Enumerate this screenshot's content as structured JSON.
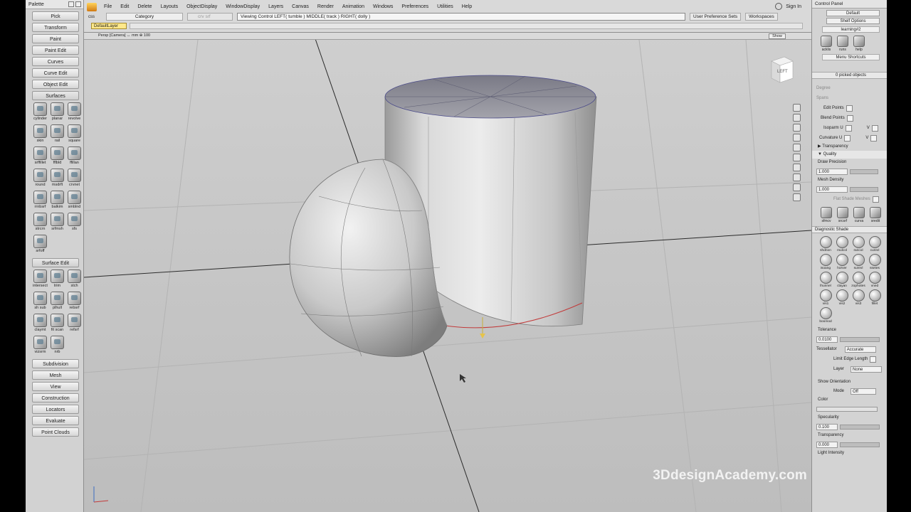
{
  "palette": {
    "title": "Palette",
    "buttons_top": [
      "Pick",
      "Transform",
      "Paint",
      "Paint Edit",
      "Curves",
      "Curve Edit",
      "Object Edit"
    ],
    "surfaces_header": "Surfaces",
    "surface_tools": [
      "cylinder",
      "planar",
      "revolve",
      "skin",
      "rail",
      "square",
      "srffillet",
      "fflbld",
      "ffillan",
      "round",
      "msdrft",
      "crvnet",
      "rrnbsrf",
      "balkim",
      "smblnd",
      "strcrn",
      "srfmsh",
      "sfs",
      "srfoff"
    ],
    "surface_edit_header": "Surface Edit",
    "surface_edit_tools": [
      "intersect",
      "trim",
      "stch",
      "sh sub",
      "plhull",
      "rebsrf",
      "claymt",
      "fit scan",
      "refsrf",
      "vizsrm",
      "nrb"
    ],
    "buttons_bottom": [
      "Subdivision",
      "Mesh",
      "View",
      "Construction",
      "Locators",
      "Evaluate",
      "Point Clouds"
    ]
  },
  "menu": {
    "items": [
      "File",
      "Edit",
      "Delete",
      "Layouts",
      "ObjectDisplay",
      "WindowDisplay",
      "Layers",
      "Canvas",
      "Render",
      "Animation",
      "Windows",
      "Preferences",
      "Utilities",
      "Help"
    ],
    "sign_in": "Sign In"
  },
  "toolbar": {
    "left_code": "css",
    "category": "Category",
    "crv_srf": "crv srf",
    "viewing_control": "Viewing Control   LEFT( tumble )   MIDDLE( track )   RIGHT( dolly )",
    "user_pref_sets": "User Preference Sets",
    "workspaces": "Workspaces",
    "default_layer": "DefaultLayer"
  },
  "viewport": {
    "header": "Persp [Camera]  ↔ mm   ⊕ 100",
    "show_label": "Show",
    "view_cube_label": "LEFT",
    "watermark": "3DdesignAcademy.com"
  },
  "control_panel": {
    "title": "Control Panel",
    "preset": "Default",
    "shelf_options": "Shelf Options",
    "shelf_tab": "learning#2",
    "shelf_icons": [
      "acklis",
      "runs",
      "help"
    ],
    "menu_shortcuts": "Menu Shortcuts",
    "picked": "0 picked objects",
    "degree_label": "Degree",
    "spans_label": "Spans",
    "edit_points": "Edit Points",
    "blend_points": "Blend Points",
    "isoparm_u": "Isoparm U",
    "isoparm_v": "V",
    "curvature_u": "Curvature U",
    "curvature_v": "V",
    "transparency_section": "Transparency",
    "quality_section": "Quality",
    "draw_precision_label": "Draw Precision",
    "draw_precision_value": "1.000",
    "mesh_density_label": "Mesh Density",
    "mesh_density_value": "1.000",
    "flat_shade_meshes": "Flat Shade Meshes",
    "shelf2_icons": [
      "sfmcv",
      "srcsrf",
      "curva",
      "sredit"
    ],
    "diagnostic_shade": "Diagnostic Shade",
    "diag_icons": [
      "shdnon",
      "mulcol",
      "rancol",
      "curevl",
      "isoang",
      "horver",
      "surevl",
      "ssetes",
      "lhunnel",
      "clayan",
      "zophotes",
      "vned",
      "vis1",
      "vis2",
      "vis3",
      "fillet",
      "boomod"
    ],
    "tolerance_label": "Tolerance",
    "tolerance_value": "0.0100",
    "tessellator_label": "Tessellator",
    "tessellator_value": "Accurate",
    "limit_edge_length": "Limit Edge Length",
    "layer_label": "Layer",
    "layer_value": "None",
    "show_orientation": "Show Orientation",
    "mode_label": "Mode",
    "mode_value": "Off",
    "color_label": "Color",
    "specularity_label": "Specularity",
    "specularity_value": "0.100",
    "transparency_label": "Transparency",
    "transparency_value": "0.000",
    "light_intensity_label": "Light Intensity"
  },
  "colors": {
    "layer_yellow": "#ffe88a",
    "cylinder_cap": "#8f8f9a",
    "seam_red": "#c23a3a"
  }
}
